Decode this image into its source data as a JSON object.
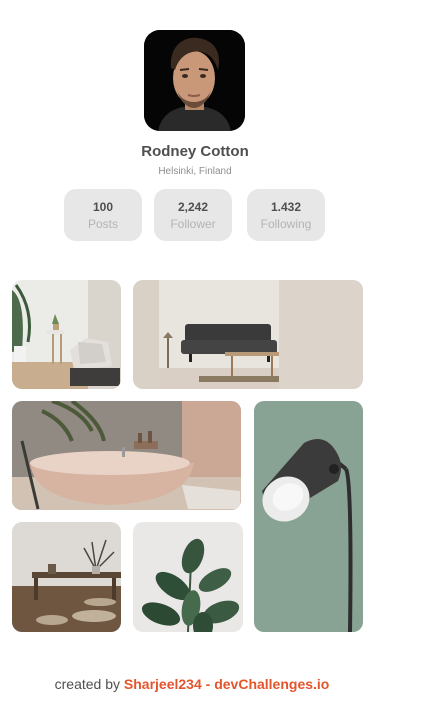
{
  "profile": {
    "name": "Rodney Cotton",
    "location": "Helsinki, Finland",
    "stats": [
      {
        "value": "100",
        "label": "Posts"
      },
      {
        "value": "2,242",
        "label": "Follower"
      },
      {
        "value": "1.432",
        "label": "Following"
      }
    ]
  },
  "gallery": {
    "items": [
      {
        "name": "living-room-chair-photo"
      },
      {
        "name": "dark-sofa-photo"
      },
      {
        "name": "bathtub-photo"
      },
      {
        "name": "floor-lamp-photo"
      },
      {
        "name": "low-table-photo"
      },
      {
        "name": "plant-photo"
      }
    ]
  },
  "footer": {
    "prefix": "created by",
    "author": "Sharjeel234",
    "separator": "-",
    "site": "devChallenges.io"
  },
  "colors": {
    "accent": "#e4552c",
    "stat_bg": "#e7e7e7",
    "text": "#4f4f4f",
    "muted": "#8e8e8e"
  }
}
